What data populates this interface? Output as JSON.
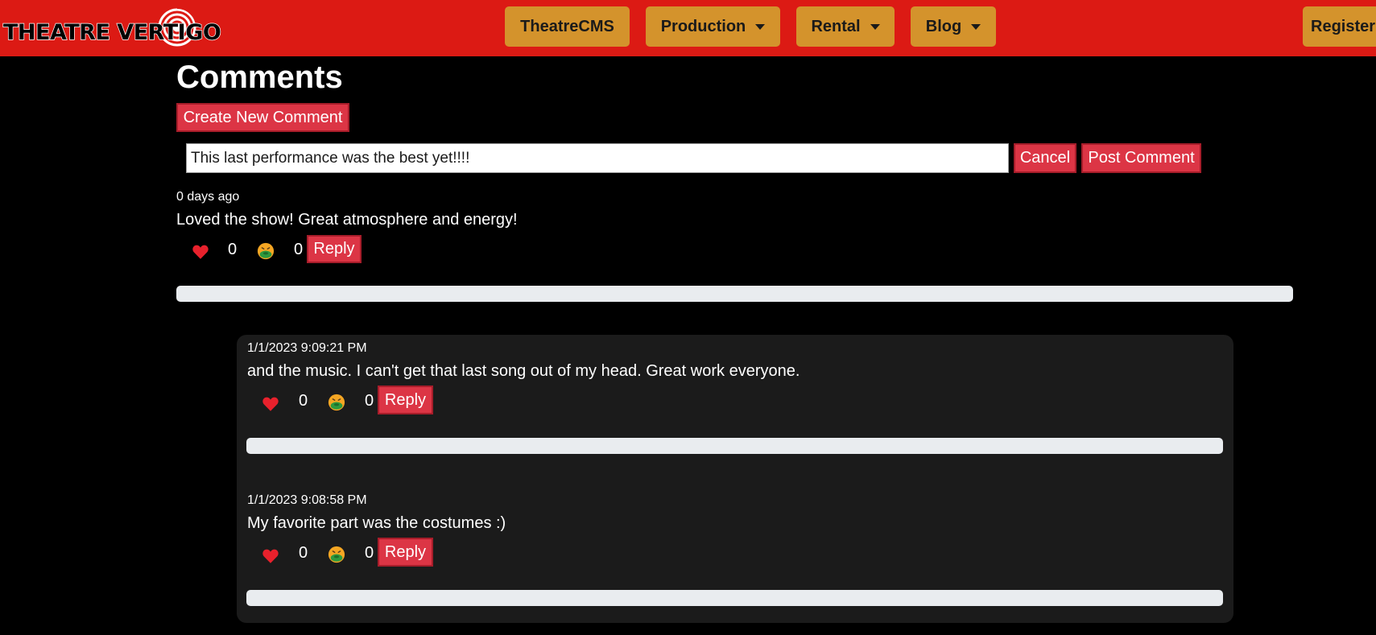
{
  "nav": {
    "logo_text": "THEATRE VERTIGO",
    "items": [
      {
        "label": "TheatreCMS",
        "dropdown": false
      },
      {
        "label": "Production",
        "dropdown": true
      },
      {
        "label": "Rental",
        "dropdown": true
      },
      {
        "label": "Blog",
        "dropdown": true
      }
    ],
    "register_label": "Register"
  },
  "page": {
    "title": "Comments",
    "create_button": "Create New Comment"
  },
  "new_comment": {
    "value": "This last performance was the best yet!!!!",
    "cancel_label": "Cancel",
    "post_label": "Post Comment"
  },
  "comments": [
    {
      "timestamp": "0 days ago",
      "text": "Loved the show! Great atmosphere and energy!",
      "likes": "0",
      "dislikes": "0",
      "reply_label": "Reply"
    }
  ],
  "replies": [
    {
      "timestamp": "1/1/2023 9:09:21 PM",
      "text": "and the music. I can't get that last song out of my head. Great work everyone.",
      "likes": "0",
      "dislikes": "0",
      "reply_label": "Reply"
    },
    {
      "timestamp": "1/1/2023 9:08:58 PM",
      "text": "My favorite part was the costumes :)",
      "likes": "0",
      "dislikes": "0",
      "reply_label": "Reply"
    }
  ],
  "icons": {
    "like": "heart-icon",
    "dislike": "nauseated-face-icon"
  },
  "colors": {
    "navbar": "#dc1a14",
    "nav_button": "#d4932c",
    "action_button": "#dc3545",
    "page_background": "#000000",
    "reply_panel": "#1b1b1b"
  }
}
